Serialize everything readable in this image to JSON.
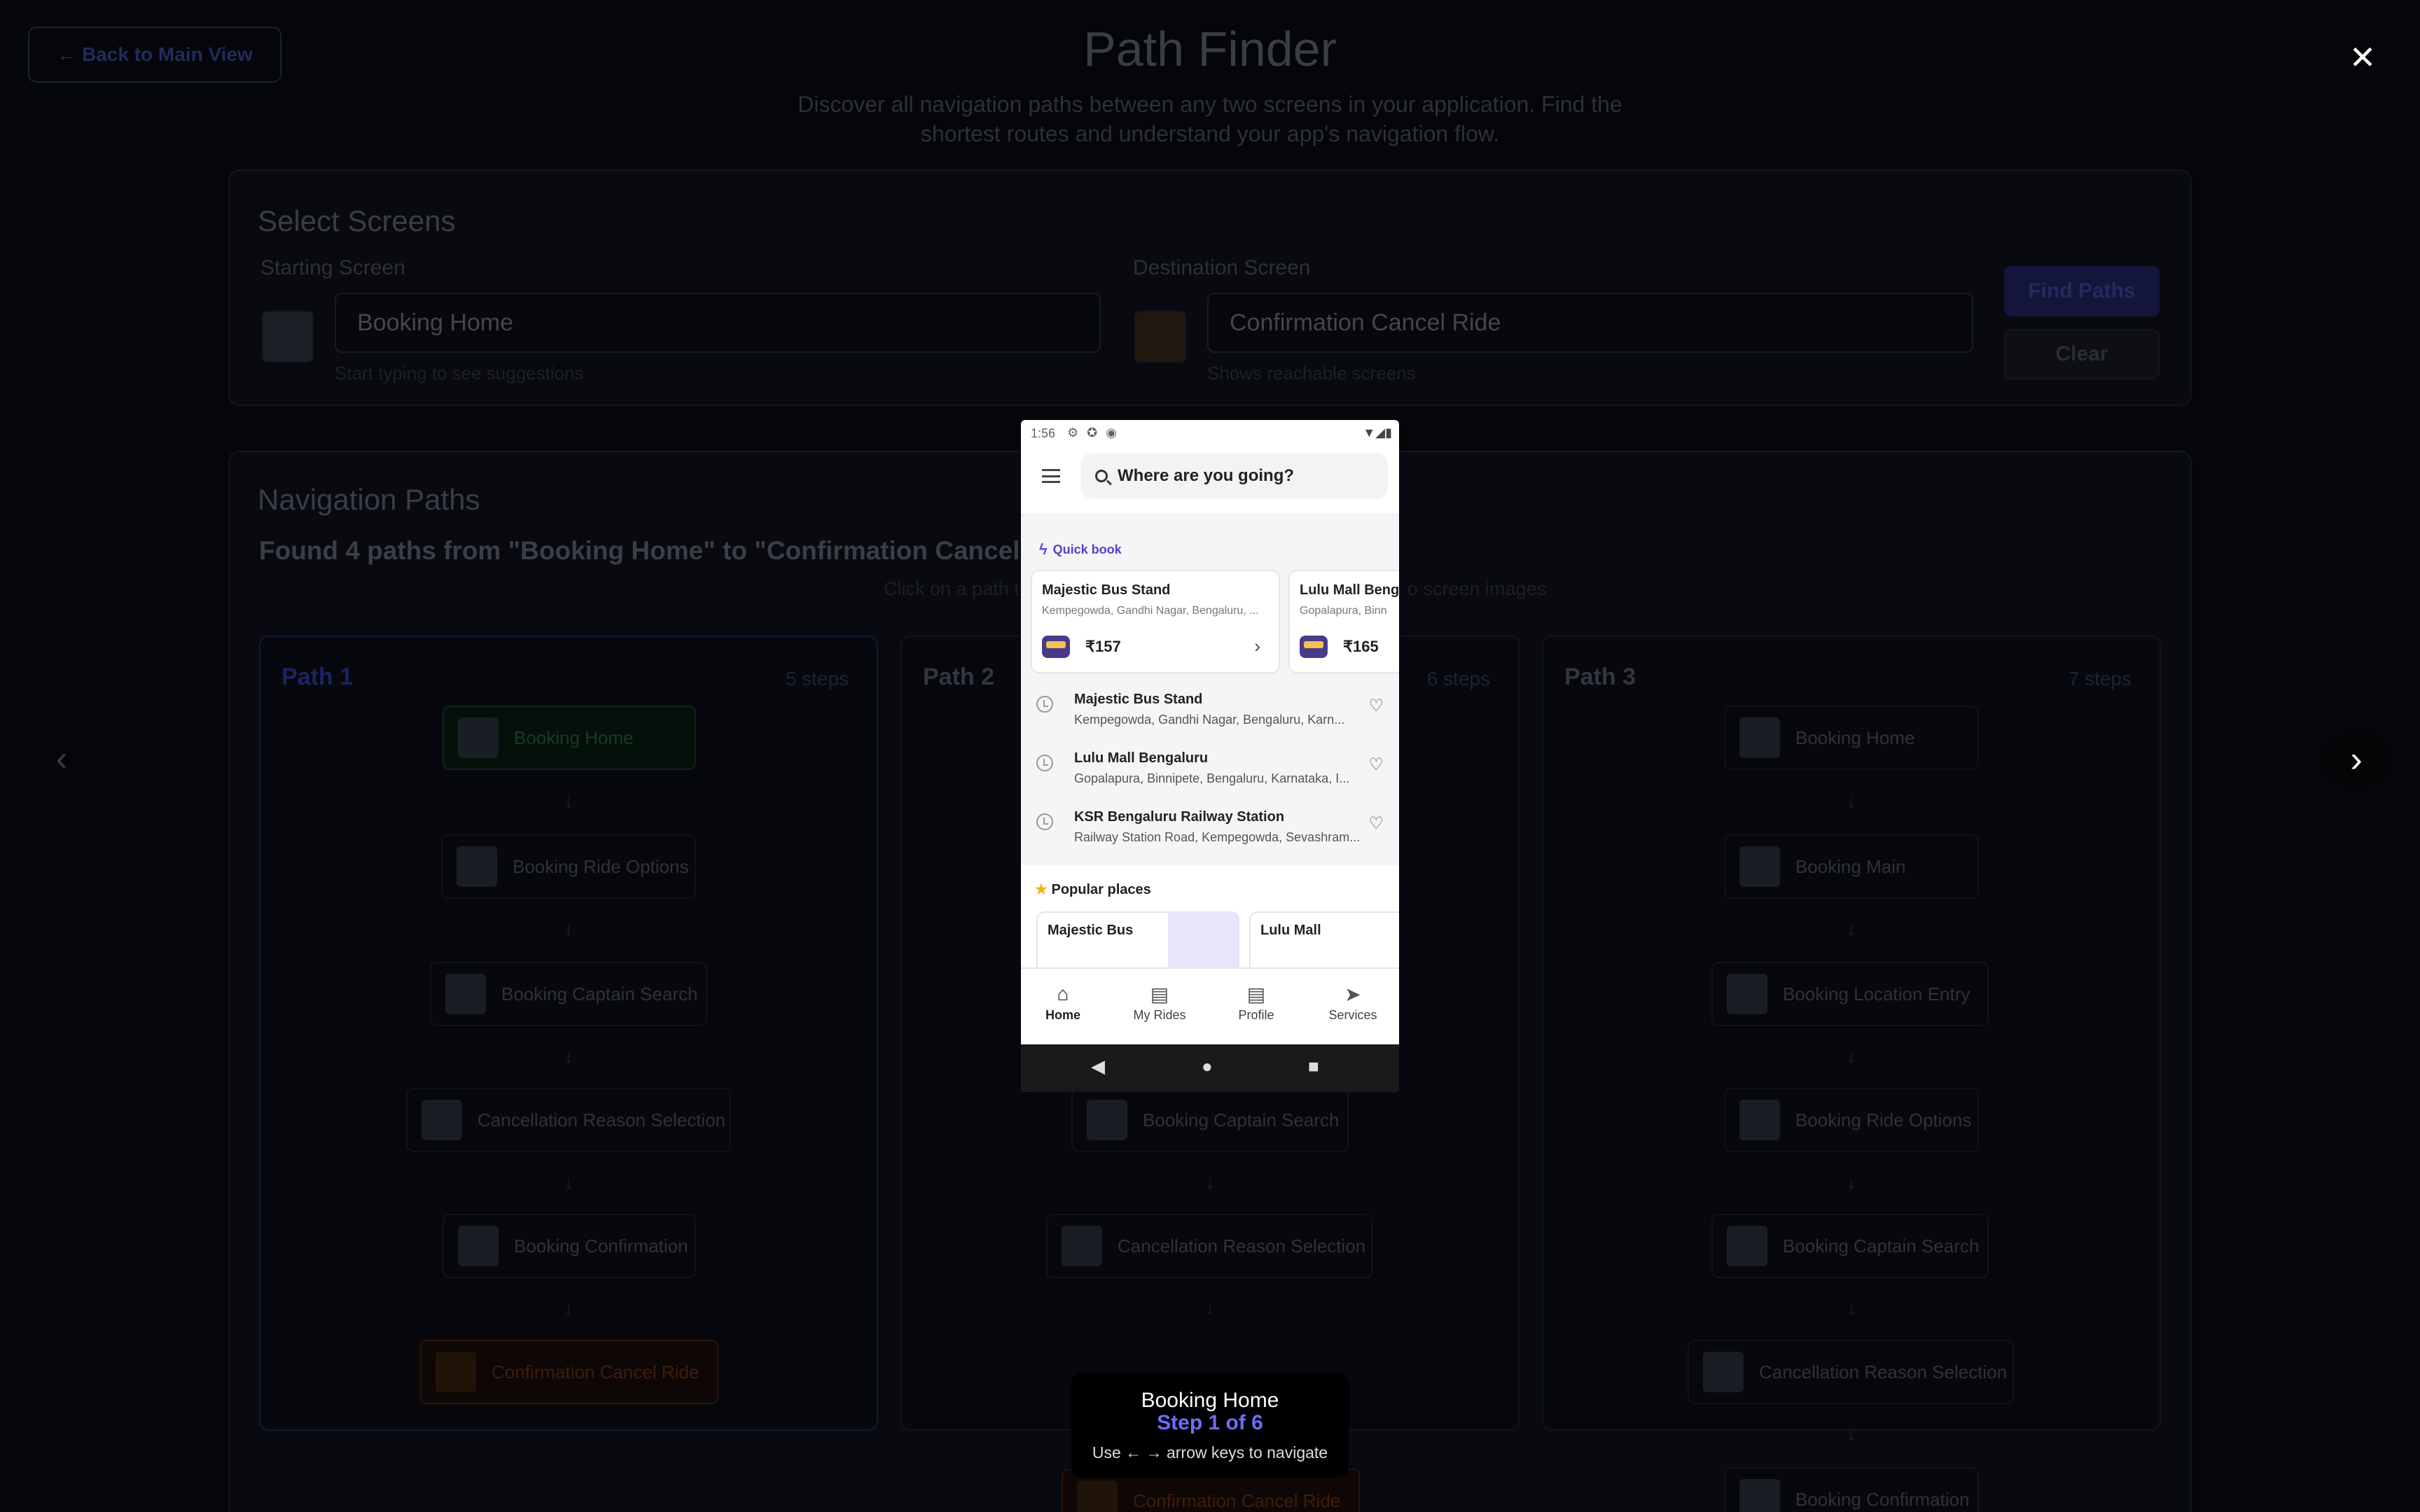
{
  "background": {
    "back_button": "← Back to Main View",
    "title": "Path Finder",
    "subtitle": "Discover all navigation paths between any two screens in your application. Find the shortest routes and understand your app's navigation flow.",
    "select": {
      "heading": "Select Screens",
      "start_label": "Starting Screen",
      "start_value": "Booking Home",
      "start_hint": "Start typing to see suggestions",
      "dest_label": "Destination Screen",
      "dest_value": "Confirmation Cancel Ride",
      "dest_hint": "Shows reachable screens",
      "find_button": "Find Paths",
      "clear_button": "Clear"
    },
    "paths": {
      "heading": "Navigation Paths",
      "found": "Found 4 paths from \"Booking Home\" to \"Confirmation Cancel Ride\"",
      "hint_left": "Click on a path t",
      "hint_right": "o screen images",
      "cards": [
        {
          "title": "Path 1",
          "steps": "5 steps",
          "nodes": [
            "Booking Home",
            "Booking Ride Options",
            "Booking Captain Search",
            "Cancellation Reason Selection",
            "Booking Confirmation",
            "Confirmation Cancel Ride"
          ]
        },
        {
          "title": "Path 2",
          "steps": "6 steps",
          "nodes": [
            "Booking Captain Search",
            "Cancellation Reason Selection",
            "Confirmation Cancel Ride"
          ]
        },
        {
          "title": "Path 3",
          "steps": "7 steps",
          "nodes": [
            "Booking Home",
            "Booking Main",
            "Booking Location Entry",
            "Booking Ride Options",
            "Booking Captain Search",
            "Cancellation Reason Selection",
            "Booking Confirmation"
          ]
        }
      ]
    }
  },
  "overlay": {
    "close_icon": "close-icon",
    "prev_glyph": "‹",
    "next_glyph": "›",
    "caption": {
      "title": "Booking Home",
      "step": "Step 1 of 6",
      "hint": "Use ← → arrow keys to navigate"
    }
  },
  "phone": {
    "status_time": "1:56",
    "search_placeholder": "Where are you going?",
    "quick_book": "Quick book",
    "quick_cards": [
      {
        "title": "Majestic Bus Stand",
        "sub": "Kempegowda, Gandhi Nagar, Bengaluru, ...",
        "price": "₹157"
      },
      {
        "title": "Lulu Mall Benga",
        "sub": "Gopalapura, Binn",
        "price": "₹165"
      }
    ],
    "recent": [
      {
        "title": "Majestic Bus Stand",
        "sub": "Kempegowda, Gandhi Nagar, Bengaluru, Karn..."
      },
      {
        "title": "Lulu Mall Bengaluru",
        "sub": "Gopalapura, Binnipete, Bengaluru, Karnataka, I..."
      },
      {
        "title": "KSR Bengaluru Railway Station",
        "sub": "Railway Station Road, Kempegowda, Sevashram..."
      }
    ],
    "popular_heading": "Popular places",
    "popular": [
      "Majestic Bus",
      "Lulu Mall"
    ],
    "tabs": [
      "Home",
      "My Rides",
      "Profile",
      "Services"
    ]
  },
  "colors": {
    "accent": "#6e6cff",
    "brand_purple": "#5b3fc4"
  }
}
